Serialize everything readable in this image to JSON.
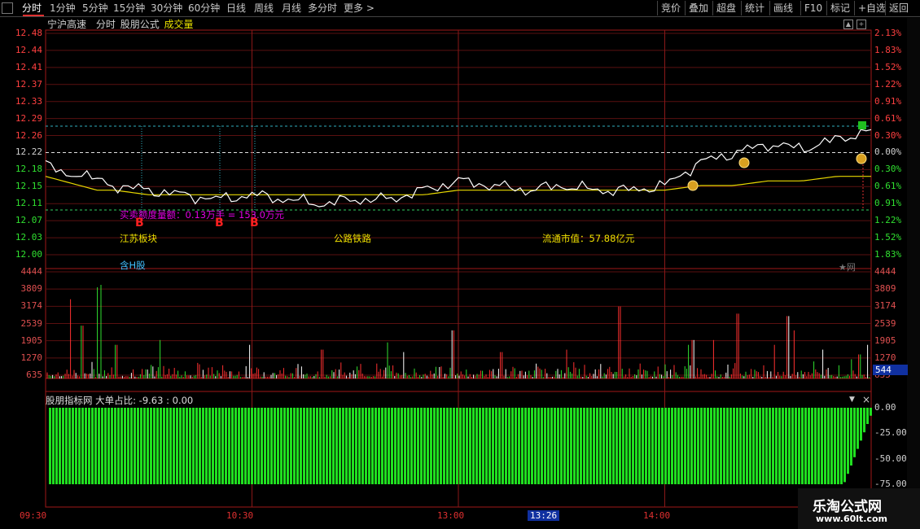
{
  "toolbar": {
    "left_items": [
      {
        "label": "分时"
      },
      {
        "label": "1分钟"
      },
      {
        "label": "5分钟"
      },
      {
        "label": "15分钟"
      },
      {
        "label": "30分钟"
      },
      {
        "label": "60分钟"
      },
      {
        "label": "日线"
      },
      {
        "label": "周线"
      },
      {
        "label": "月线"
      },
      {
        "label": "多分时"
      },
      {
        "label": "更多 >"
      }
    ],
    "right_items": [
      {
        "label": "竞价"
      },
      {
        "label": "叠加"
      },
      {
        "label": "超盘"
      },
      {
        "label": "统计"
      },
      {
        "label": "画线"
      },
      {
        "label": "F10"
      },
      {
        "label": "标记"
      },
      {
        "label": "+自选"
      },
      {
        "label": "返回"
      }
    ]
  },
  "chart_header": {
    "stock_name": "宁沪高速",
    "mode": "分时",
    "formula": "股朋公式",
    "volume_label": "成交量"
  },
  "price_axis_left": [
    "12.48",
    "12.44",
    "12.41",
    "12.37",
    "12.33",
    "12.29",
    "12.26",
    "12.22",
    "12.18",
    "12.15",
    "12.11",
    "12.07",
    "12.03",
    "12.00"
  ],
  "pct_axis_right": [
    "2.13%",
    "1.83%",
    "1.52%",
    "1.22%",
    "0.91%",
    "0.61%",
    "0.30%",
    "0.00%",
    "0.30%",
    "0.61%",
    "0.91%",
    "1.22%",
    "1.52%",
    "1.83%"
  ],
  "volume_axis": [
    "4444",
    "3809",
    "3174",
    "2539",
    "1905",
    "1270",
    "635"
  ],
  "volume_current": "544",
  "annotations": {
    "buysell_quota": "买卖额度量额：0.13万手 = 153.0万元",
    "buy_marker": "B",
    "sector": "江苏板块",
    "industry": "公路铁路",
    "market_cap": "流通市值：57.88亿元",
    "h_share": "含H股",
    "star_tag": "★网"
  },
  "indicator": {
    "title": "股朋指标网  大单占比: -9.63 : 0.00",
    "axis": [
      "0.00",
      "-25.00",
      "-50.00",
      "-75.00"
    ]
  },
  "time_axis": [
    "09:30",
    "10:30",
    "13:00",
    "13:26",
    "14:00"
  ],
  "watermark": {
    "line1": "乐淘公式网",
    "line2": "www.60lt.com"
  },
  "chart_data": {
    "type": "line",
    "title": "",
    "xlabel": "",
    "ylabel": "",
    "ylim": [
      12.0,
      12.48
    ],
    "prev_close": 12.22,
    "x": [
      0,
      5,
      10,
      15,
      20,
      30,
      40,
      50,
      60,
      70,
      80,
      90,
      100,
      110,
      120,
      130,
      140,
      150,
      160,
      170,
      180,
      190,
      200,
      210,
      220,
      230,
      240
    ],
    "series": [
      {
        "values": [
          12.2,
          12.17,
          12.18,
          12.16,
          12.15,
          12.14,
          12.13,
          12.12,
          12.13,
          12.12,
          12.11,
          12.12,
          12.12,
          12.14,
          12.16,
          12.15,
          12.14,
          12.15,
          12.14,
          12.14,
          12.15,
          12.2,
          12.22,
          12.24,
          12.23,
          12.25,
          12.27
        ]
      },
      {
        "values": [
          12.17,
          12.16,
          12.15,
          12.14,
          12.14,
          12.13,
          12.13,
          12.13,
          12.13,
          12.13,
          12.13,
          12.13,
          12.13,
          12.13,
          12.14,
          12.14,
          12.14,
          12.14,
          12.14,
          12.14,
          12.14,
          12.15,
          12.15,
          12.16,
          12.16,
          12.17,
          12.17
        ]
      }
    ],
    "volume_ylim": [
      0,
      4444
    ],
    "indicator_ylim": [
      -100,
      0
    ]
  }
}
